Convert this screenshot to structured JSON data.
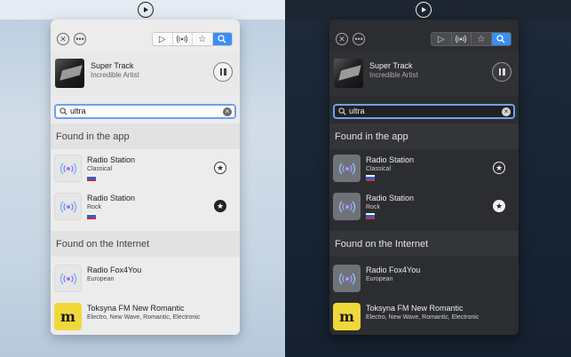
{
  "menubar": {
    "icon": "play-circle-icon"
  },
  "toolbar": {
    "close_icon": "close-icon",
    "more_icon": "more-icon",
    "tabs": [
      {
        "icon": "play-icon",
        "glyph": "▷"
      },
      {
        "icon": "radio-waves-icon",
        "glyph": "◉"
      },
      {
        "icon": "star-icon",
        "glyph": "☆"
      },
      {
        "icon": "search-icon",
        "glyph": "⌕",
        "active": true
      }
    ]
  },
  "now_playing": {
    "title": "Super Track",
    "artist": "Incredible Artist",
    "control": "pause-icon"
  },
  "search": {
    "value": "ultra",
    "clear_icon": "clear-icon"
  },
  "sections": {
    "app": "Found in the app",
    "internet": "Found on the Internet"
  },
  "app_results": [
    {
      "title": "Radio Station",
      "subtitle": "Classical",
      "flag": "russia-flag-icon",
      "favorite": false
    },
    {
      "title": "Radio Station",
      "subtitle": "Rock",
      "flag": "russia-flag-icon",
      "favorite": true
    }
  ],
  "internet_results": [
    {
      "title": "Radio Fox4You",
      "subtitle": "European",
      "thumb": "radio-waves-icon"
    },
    {
      "title": "Toksyna FM New Romantic",
      "subtitle": "Electro, New Wave, Romantic, Electronic",
      "thumb": "toksyna-logo",
      "logo_text": "m"
    }
  ],
  "colors": {
    "accent": "#3b8ef3",
    "radio_icon_a": "#8b7cf6",
    "radio_icon_b": "#6fb1f5"
  }
}
